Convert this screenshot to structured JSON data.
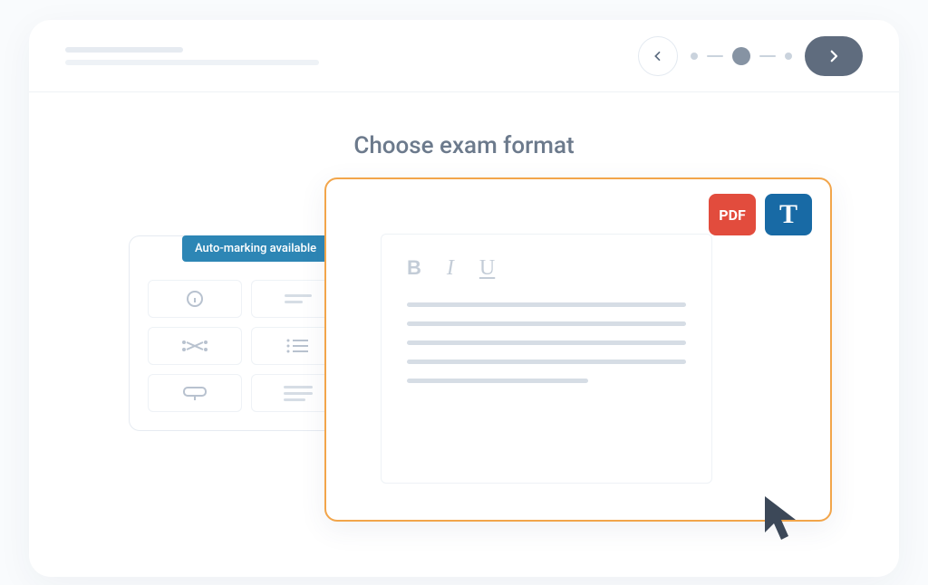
{
  "heading": "Choose exam format",
  "badge_auto": "Auto-marking available",
  "pdf_label": "PDF",
  "t_label": "T",
  "toolbar": {
    "bold": "B",
    "italic": "I",
    "underline": "U"
  },
  "stepper": {
    "current": 2,
    "total": 3
  }
}
